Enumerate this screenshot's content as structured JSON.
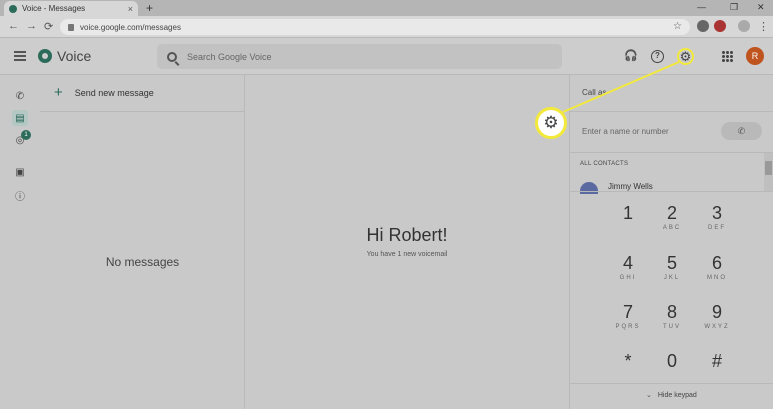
{
  "browser": {
    "tab_title": "Voice - Messages",
    "tab_close": "×",
    "new_tab": "+",
    "url": "voice.google.com/messages",
    "back": "←",
    "forward": "→",
    "reload": "⟳",
    "star": "☆",
    "minimize": "—",
    "maximize": "❐",
    "close": "✕",
    "more": "⋮"
  },
  "header": {
    "app_name": "Voice",
    "search_placeholder": "Search Google Voice",
    "avatar_initial": "R"
  },
  "rail": {
    "calls_icon": "✆",
    "messages_icon": "▤",
    "voicemail_icon": "◎",
    "voicemail_badge": "1",
    "archive_icon": "▣",
    "spam_icon": "ⓘ"
  },
  "messages": {
    "send_new": "Send new message",
    "empty": "No messages"
  },
  "center": {
    "greeting": "Hi Robert!",
    "voicemail_note": "You have 1 new voicemail"
  },
  "right_panel": {
    "call_as": "Call as",
    "number_placeholder": "Enter a name or number",
    "call_icon": "✆",
    "contacts_header": "ALL CONTACTS",
    "contacts": [
      {
        "name": "Jimmy Wells"
      }
    ],
    "keys": [
      {
        "digit": "1",
        "letters": ""
      },
      {
        "digit": "2",
        "letters": "ABC"
      },
      {
        "digit": "3",
        "letters": "DEF"
      },
      {
        "digit": "4",
        "letters": "GHI"
      },
      {
        "digit": "5",
        "letters": "JKL"
      },
      {
        "digit": "6",
        "letters": "MNO"
      },
      {
        "digit": "7",
        "letters": "PQRS"
      },
      {
        "digit": "8",
        "letters": "TUV"
      },
      {
        "digit": "9",
        "letters": "WXYZ"
      },
      {
        "digit": "*",
        "letters": ""
      },
      {
        "digit": "0",
        "letters": ""
      },
      {
        "digit": "#",
        "letters": ""
      }
    ],
    "hide_keypad": "Hide keypad"
  },
  "colors": {
    "accent": "#2c6b5a",
    "highlight": "#f2e93b",
    "avatar": "#c0541f"
  }
}
